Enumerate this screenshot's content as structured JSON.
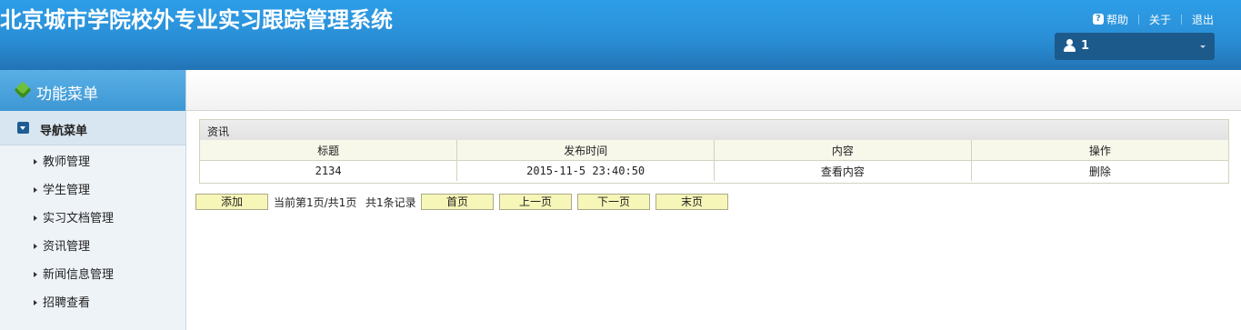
{
  "header": {
    "title": "北京城市学院校外专业实习跟踪管理系统",
    "links": {
      "help": "帮助",
      "about": "关于",
      "logout": "退出"
    },
    "user": {
      "name": "1"
    }
  },
  "sidebar": {
    "menu_title": "功能菜单",
    "nav_title": "导航菜单",
    "items": [
      {
        "label": "教师管理"
      },
      {
        "label": "学生管理"
      },
      {
        "label": "实习文档管理"
      },
      {
        "label": "资讯管理"
      },
      {
        "label": "新闻信息管理"
      },
      {
        "label": "招聘查看"
      }
    ]
  },
  "panel": {
    "title": "资讯",
    "columns": [
      "标题",
      "发布时间",
      "内容",
      "操作"
    ],
    "rows": [
      {
        "title": "2134",
        "time": "2015-11-5 23:40:50",
        "content": "查看内容",
        "action": "删除"
      }
    ]
  },
  "pager": {
    "add": "添加",
    "page_info": "当前第1页/共1页",
    "record_info": "共1条记录",
    "first": "首页",
    "prev": "上一页",
    "next": "下一页",
    "last": "末页"
  }
}
